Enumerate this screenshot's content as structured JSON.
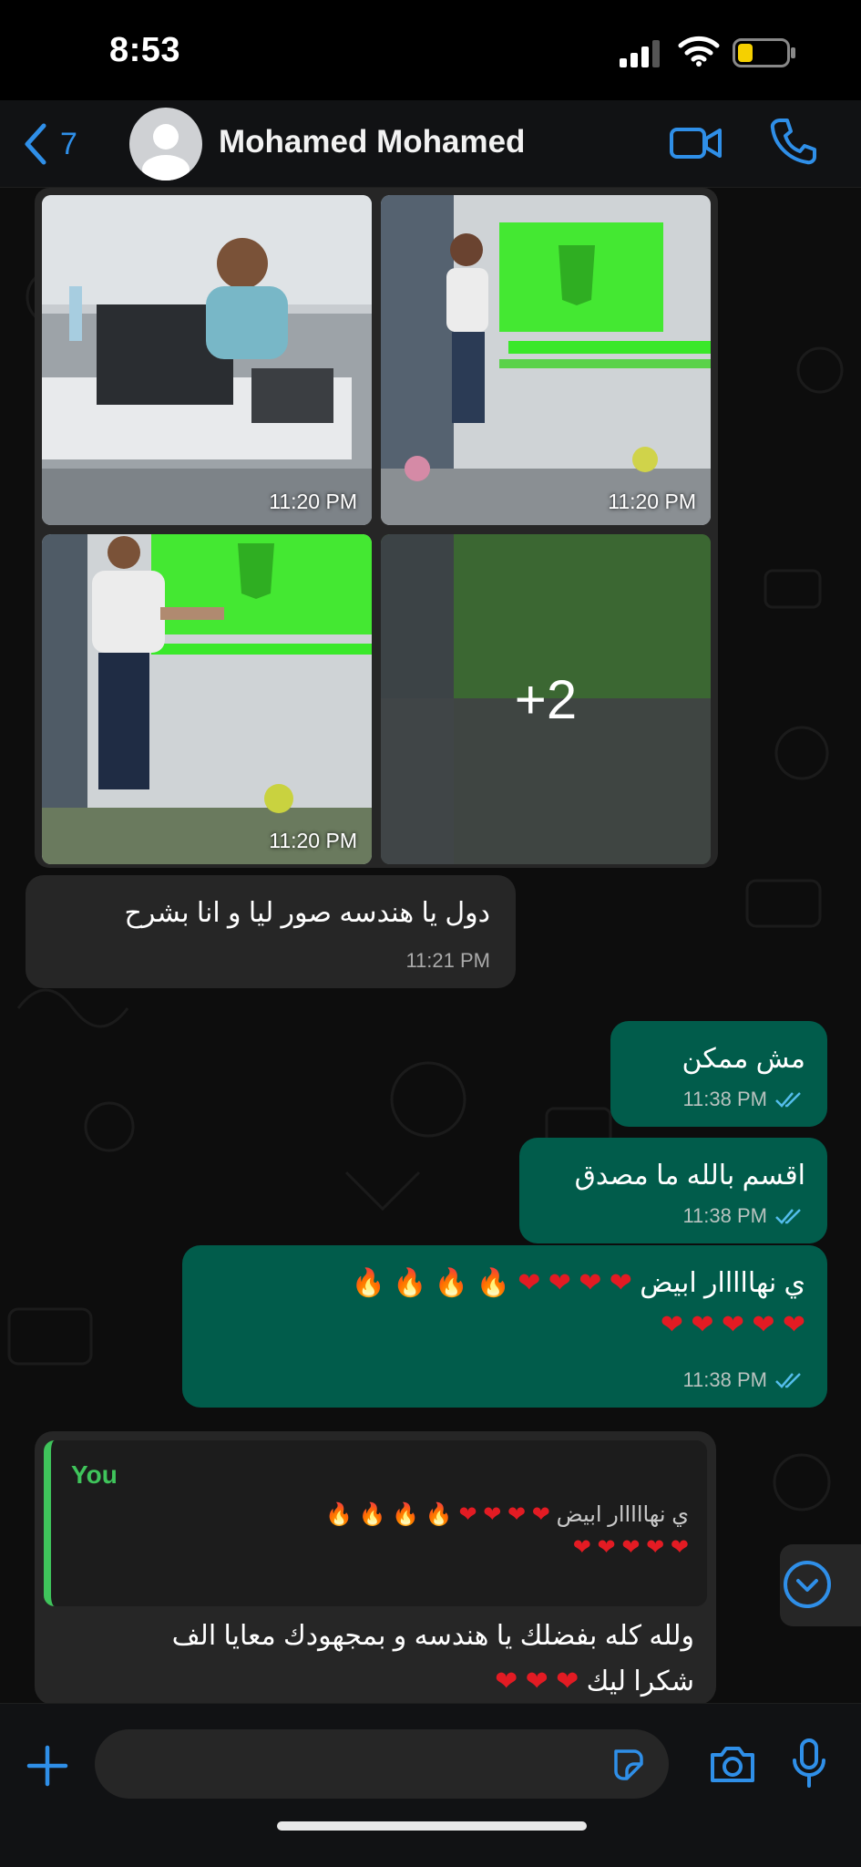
{
  "status_bar": {
    "time": "8:53"
  },
  "header": {
    "back_count": "7",
    "contact_name": "Mohamed Mohamed"
  },
  "album": {
    "photos": [
      {
        "time": "11:20 PM"
      },
      {
        "time": "11:20 PM"
      },
      {
        "time": "11:20 PM"
      },
      {
        "time": "",
        "more_label": "+2"
      }
    ]
  },
  "messages": [
    {
      "direction": "in",
      "text": "دول يا هندسه صور ليا و انا بشرح",
      "time": "11:21 PM"
    },
    {
      "direction": "out",
      "text": "مش ممكن",
      "time": "11:38 PM"
    },
    {
      "direction": "out",
      "text": "اقسم بالله ما مصدق",
      "time": "11:38 PM"
    },
    {
      "direction": "out",
      "text": "ي نهااااار ابيض",
      "time": "11:38 PM"
    },
    {
      "direction": "in",
      "reply_to_name": "You",
      "reply_to_text": "ي نهااااار ابيض",
      "line1": "ولله كله بفضلك يا هندسه و بمجهودك معايا الف",
      "line2": "شكرا ليك"
    }
  ],
  "colors": {
    "accent": "#2f8fe8",
    "outgoing_bubble": "#015c4b",
    "incoming_bubble": "#262626",
    "quote_bar": "#3fc45b",
    "heart": "#e31b23"
  },
  "icons": [
    "chevron-left-icon",
    "video-camera-icon",
    "phone-icon",
    "plus-icon",
    "sticker-icon",
    "camera-icon",
    "microphone-icon",
    "chevron-down-icon",
    "read-ticks-icon"
  ]
}
